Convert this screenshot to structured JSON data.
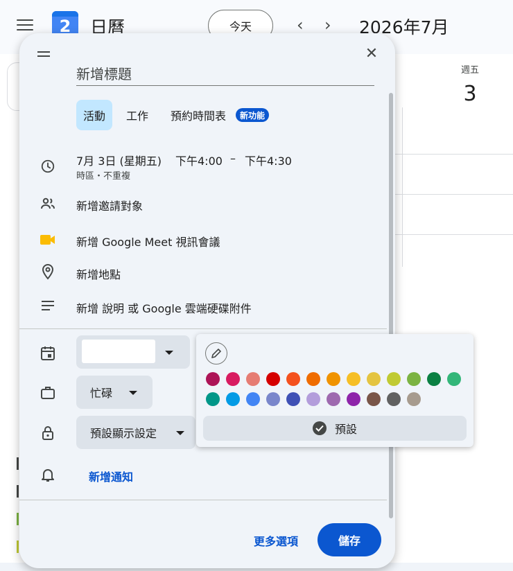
{
  "app": {
    "name": "日曆",
    "logo_day": "2",
    "today_label": "今天",
    "prev_arrow": "‹",
    "next_arrow": "›",
    "month": "2026年7月"
  },
  "calendar": {
    "weekday": "週五",
    "day_number": "3"
  },
  "dialog": {
    "title_placeholder": "新增標題",
    "tabs": [
      {
        "label": "活動",
        "active": true
      },
      {
        "label": "工作",
        "active": false
      },
      {
        "label": "預約時間表",
        "active": false
      }
    ],
    "new_badge": "新功能",
    "date_text": "7月 3日 (星期五)",
    "time_start": "下午4:00",
    "time_sep": "–",
    "time_end": "下午4:30",
    "time_sub": "時區・不重複",
    "add_guests": "新增邀請對象",
    "add_meet": "新增 Google Meet 視訊會議",
    "add_location": "新增地點",
    "add_description": "新增 說明 或 Google 雲端硬碟附件",
    "busy_label": "忙碌",
    "visibility_label": "預設顯示設定",
    "add_notification": "新增通知",
    "more_options": "更多選項",
    "save": "儲存",
    "close_glyph": "✕"
  },
  "color_popup": {
    "default_label": "預設",
    "colors_row1": [
      "#ad1457",
      "#d81b60",
      "#e67c73",
      "#d50000",
      "#f4511e",
      "#ef6c00",
      "#f09300",
      "#f6bf26",
      "#e4c441",
      "#c0ca33",
      "#7cb342",
      "#0b8043",
      "#33b679"
    ],
    "colors_row2": [
      "#009688",
      "#039be5",
      "#4285f4",
      "#7986cb",
      "#3f51b5",
      "#b39ddb",
      "#9e69af",
      "#8e24aa",
      "#795548",
      "#616161",
      "#a79b8e"
    ]
  },
  "theme": {
    "accent": "#0b57d0",
    "tab_active_bg": "#c2e7ff",
    "surface": "#f0f4f9",
    "meet_yellow": "#fbbc04"
  }
}
